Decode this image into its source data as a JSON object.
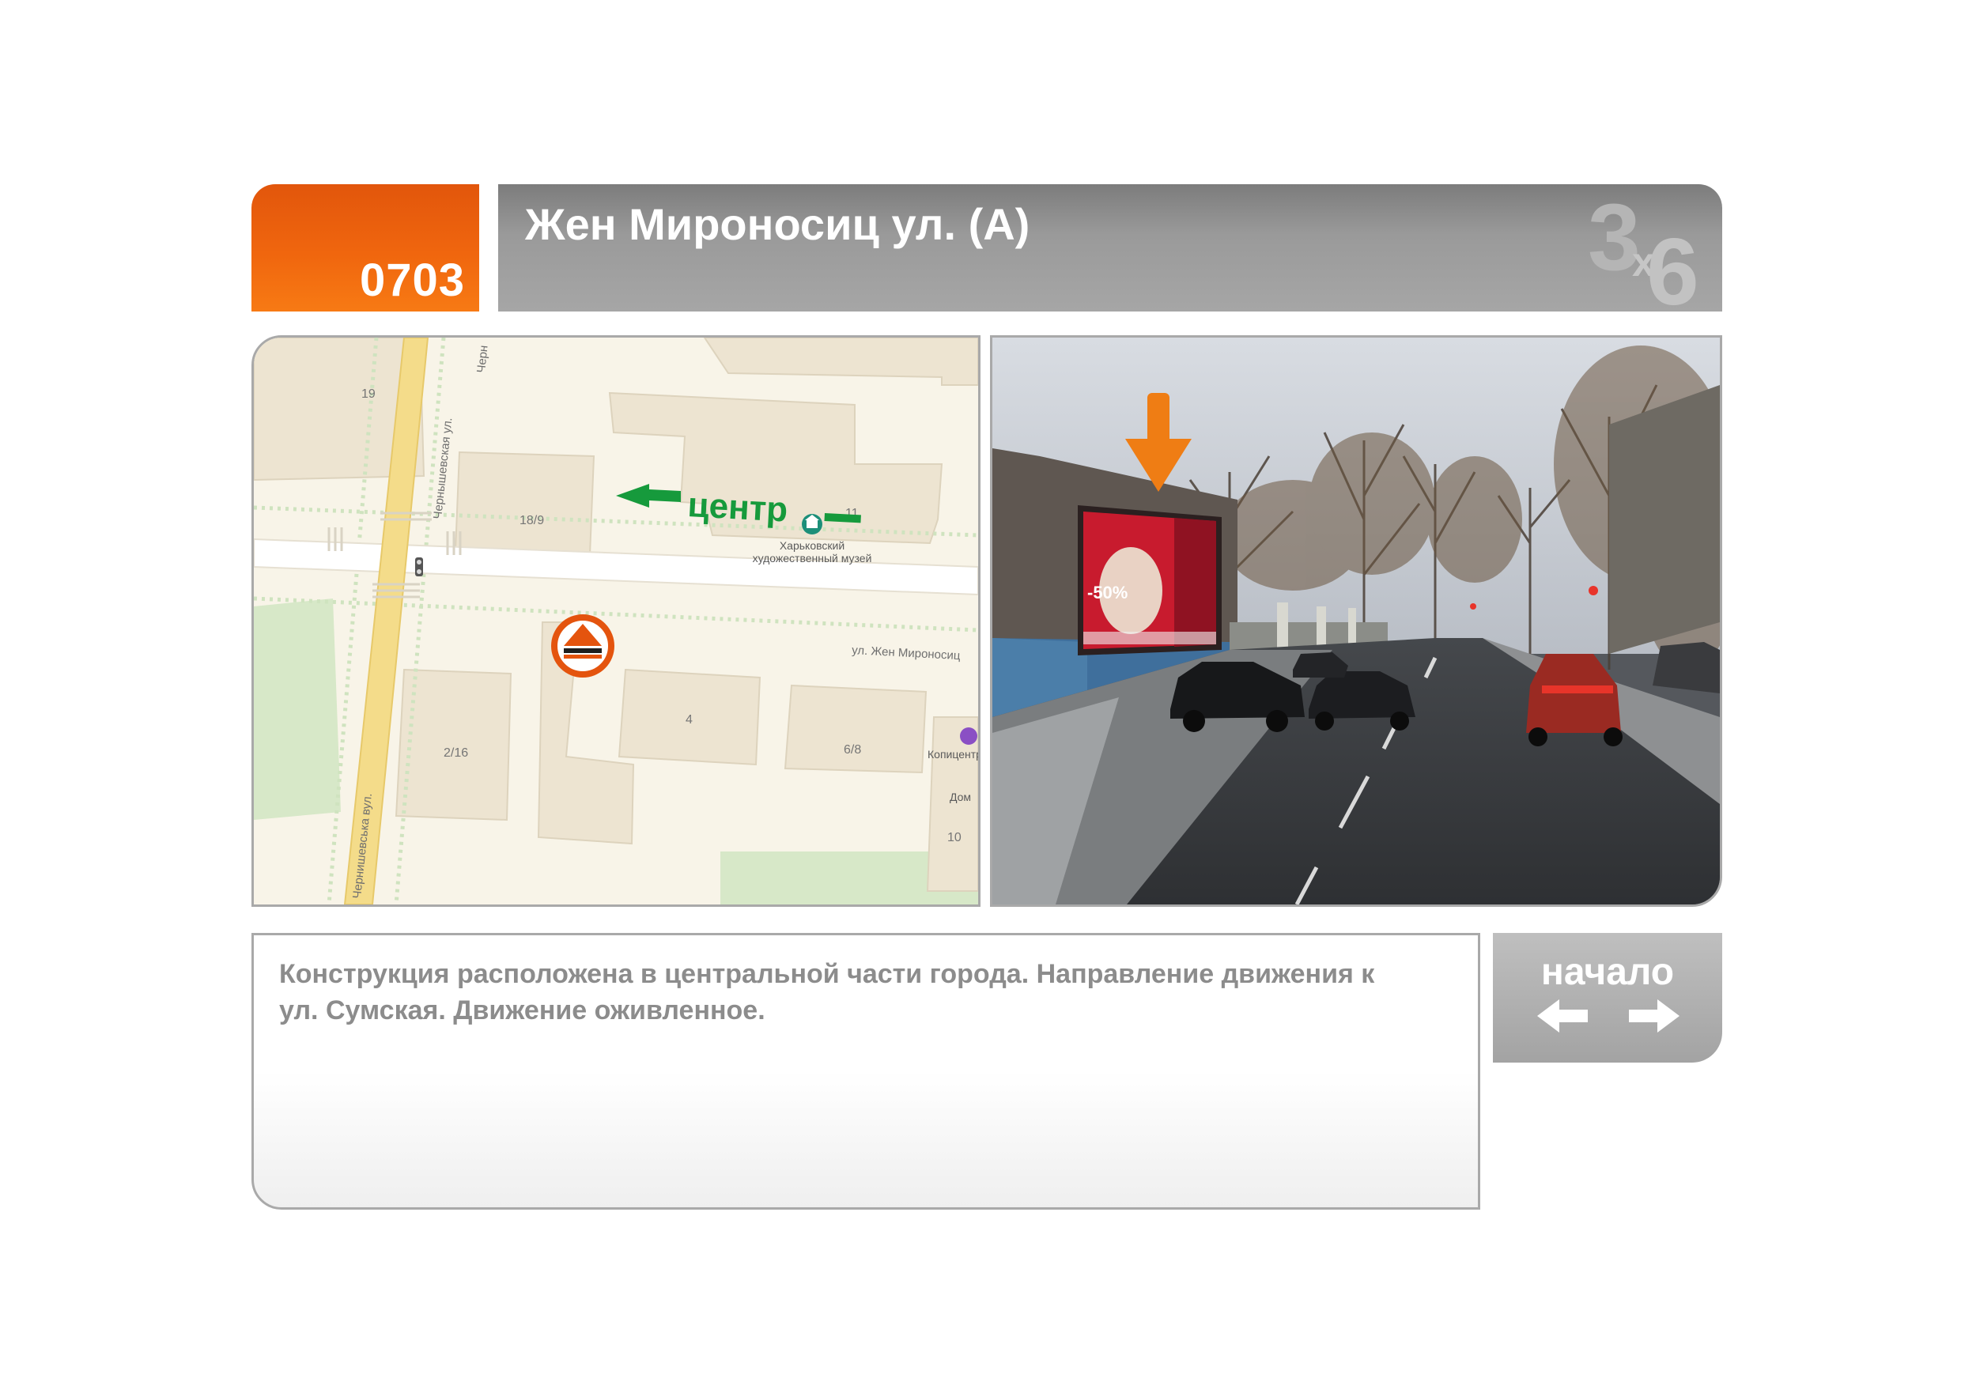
{
  "header": {
    "code": "0703",
    "title": "Жен Мироносиц ул.  (А)",
    "logo_main": "3",
    "logo_sub": "x",
    "logo_tail": "6"
  },
  "map": {
    "labels": {
      "b19": "19",
      "b18_9": "18/9",
      "b11": "11",
      "b4": "4",
      "b2_16": "2/16",
      "b6_8": "6/8",
      "b10": "10",
      "museum_line1": "Харьковский",
      "museum_line2": "художественный музей",
      "copycenter": "Копицентр",
      "dom": "Дом",
      "street_cherny_ru": "Чернышевская ул.",
      "street_cherny_ru2": "Черн",
      "street_cherny_ua": "Чернишевська вул.",
      "street_zhen": "ул. Жен Мироносиц"
    },
    "direction_label": "центр",
    "colors": {
      "direction": "#169a3c",
      "marker": "#e4540e",
      "road_yellow": "#f4dc8a",
      "building": "#ede4d1"
    }
  },
  "photo": {
    "billboard_discount": "-50%",
    "arrow_color": "#ef7d14"
  },
  "description": {
    "text": "Конструкция расположена в центральной части города. Направление движения к ул. Сумская. Движение оживленное."
  },
  "nav": {
    "label": "начало",
    "left_icon": "arrow-left-icon",
    "right_icon": "arrow-right-icon"
  },
  "colors": {
    "accent": "#f0660e",
    "header_gray": "#9a9a9a",
    "text_gray": "#8c8c8c",
    "border_gray": "#a9a9a9"
  }
}
